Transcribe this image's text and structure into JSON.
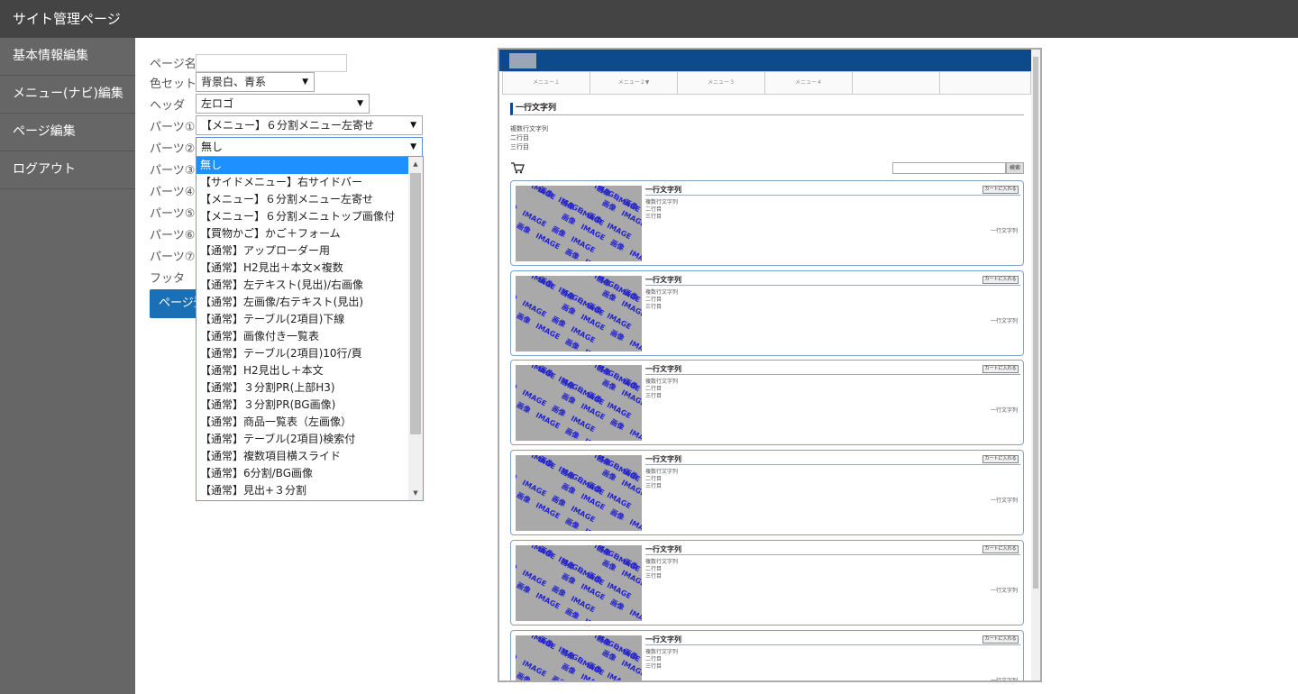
{
  "app": {
    "title": "サイト管理ページ"
  },
  "sidebar": {
    "items": [
      {
        "label": "基本情報編集"
      },
      {
        "label": "メニュー(ナビ)編集"
      },
      {
        "label": "ページ編集"
      },
      {
        "label": "ログアウト"
      }
    ]
  },
  "form": {
    "page_name": {
      "label": "ページ名",
      "value": ""
    },
    "color_set": {
      "label": "色セット",
      "value": "背景白、青系"
    },
    "header": {
      "label": "ヘッダ",
      "value": "左ロゴ"
    },
    "parts": [
      {
        "label": "パーツ①",
        "value": "【メニュー】６分割メニュー左寄せ"
      },
      {
        "label": "パーツ②",
        "value": "無し"
      },
      {
        "label": "パーツ③"
      },
      {
        "label": "パーツ④"
      },
      {
        "label": "パーツ⑤"
      },
      {
        "label": "パーツ⑥"
      },
      {
        "label": "パーツ⑦"
      }
    ],
    "footer": {
      "label": "フッタ"
    },
    "register_button": "ページ登録"
  },
  "dropdown": {
    "selected_index": 0,
    "options": [
      "無し",
      "【サイドメニュー】右サイドバー",
      "【メニュー】６分割メニュー左寄せ",
      "【メニュー】６分割メニュトップ画像付",
      "【買物かご】かご＋フォーム",
      "【通常】アップローダー用",
      "【通常】H2見出＋本文×複数",
      "【通常】左テキスト(見出)/右画像",
      "【通常】左画像/右テキスト(見出)",
      "【通常】テーブル(2項目)下線",
      "【通常】画像付き一覧表",
      "【通常】テーブル(2項目)10行/頁",
      "【通常】H2見出し＋本文",
      "【通常】３分割PR(上部H3)",
      "【通常】３分割PR(BG画像)",
      "【通常】商品一覧表（左画像）",
      "【通常】テーブル(2項目)検索付",
      "【通常】複数項目横スライド",
      "【通常】6分割/BG画像",
      "【通常】見出+３分割"
    ]
  },
  "preview": {
    "menu": [
      "メニュー１",
      "メニュー２▼",
      "メニュー３",
      "メニュー４",
      ""
    ],
    "title": "一行文字列",
    "multi_lines": [
      "複数行文字列",
      "二行目",
      "三行目"
    ],
    "search_button": "検索",
    "image_text": "画像　IMAGE　画像　IMAGE",
    "cards": [
      {
        "title": "一行文字列",
        "button": "カートに入れる",
        "lines": [
          "複数行文字列",
          "二行目",
          "三行目"
        ],
        "right": "一行文字列"
      },
      {
        "title": "一行文字列",
        "button": "カートに入れる",
        "lines": [
          "複数行文字列",
          "二行目",
          "三行目"
        ],
        "right": "一行文字列"
      },
      {
        "title": "一行文字列",
        "button": "カートに入れる",
        "lines": [
          "複数行文字列",
          "二行目",
          "三行目"
        ],
        "right": "一行文字列"
      },
      {
        "title": "一行文字列",
        "button": "カートに入れる",
        "lines": [
          "複数行文字列",
          "二行目",
          "三行目"
        ],
        "right": "一行文字列"
      },
      {
        "title": "一行文字列",
        "button": "カートに入れる",
        "lines": [
          "複数行文字列",
          "二行目",
          "三行目"
        ],
        "right": "一行文字列"
      },
      {
        "title": "一行文字列",
        "button": "カートに入れる",
        "lines": [
          "複数行文字列",
          "二行目",
          "三行目"
        ],
        "right": "一行文字列"
      }
    ]
  },
  "colors": {
    "topbar": "#444444",
    "sidebar": "#666666",
    "accent": "#1a6fb5",
    "preview_header": "#0d4a8c",
    "dropdown_selected": "#1e90ff"
  }
}
